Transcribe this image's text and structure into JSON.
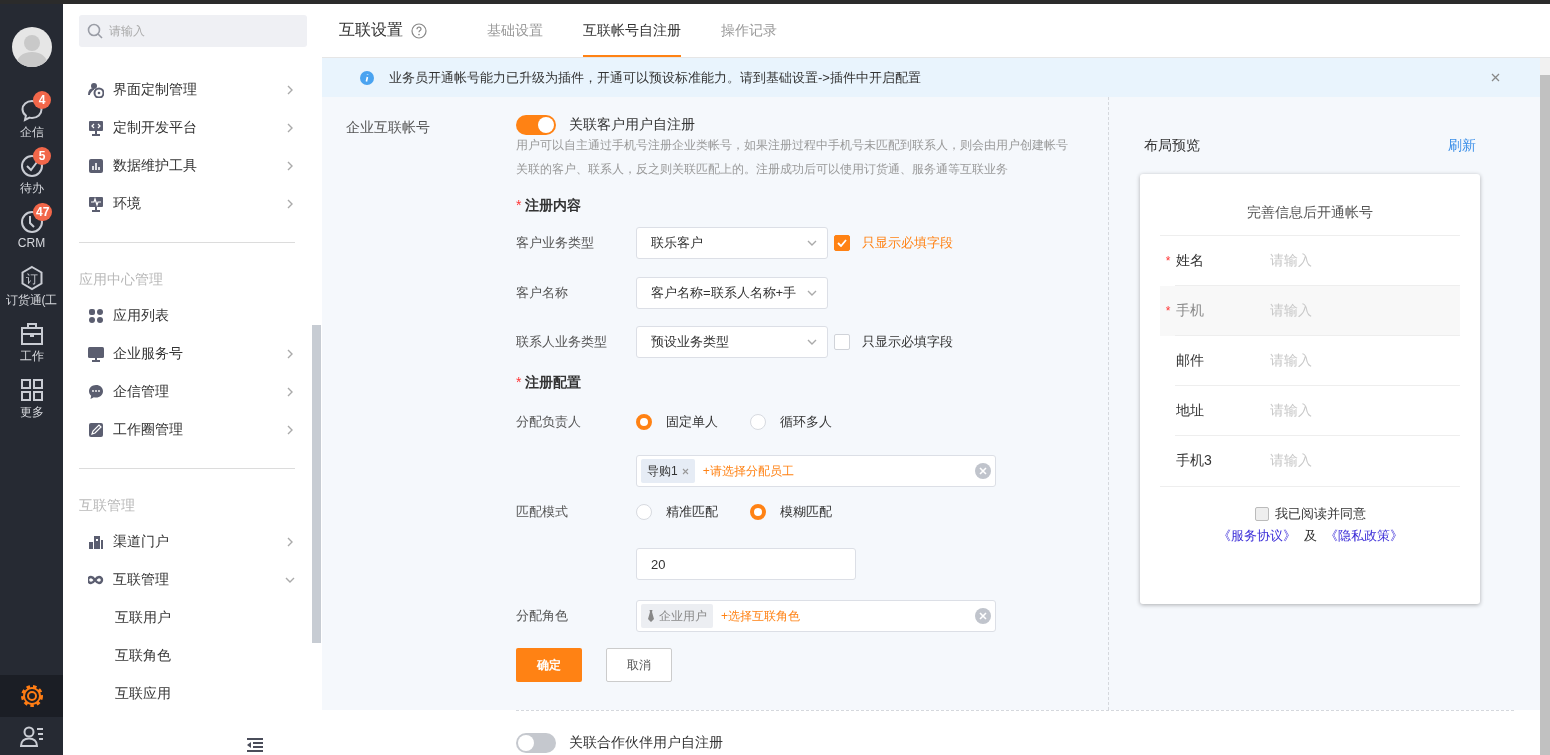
{
  "rail": {
    "items": [
      {
        "kind": "chat",
        "label": "企信",
        "badge": "4"
      },
      {
        "kind": "todo",
        "label": "待办",
        "badge": "5"
      },
      {
        "kind": "crm",
        "label": "CRM",
        "badge": "47"
      },
      {
        "kind": "order",
        "label": "订货通(工",
        "icon_char": "订"
      },
      {
        "kind": "work",
        "label": "工作"
      },
      {
        "kind": "more",
        "label": "更多"
      }
    ],
    "bottom": [
      {
        "kind": "settings",
        "selected": true
      },
      {
        "kind": "contacts",
        "selected": false
      }
    ]
  },
  "menu": {
    "search": {
      "placeholder": "请输入"
    },
    "sections": [
      {
        "items": [
          {
            "kind": "ui",
            "label": "界面定制管理",
            "expanded": false
          },
          {
            "kind": "dev",
            "label": "定制开发平台",
            "expanded": false
          },
          {
            "kind": "data",
            "label": "数据维护工具",
            "expanded": false
          },
          {
            "kind": "env",
            "label": "环境",
            "expanded": false
          }
        ]
      },
      {
        "title": "应用中心管理",
        "items": [
          {
            "kind": "apps",
            "label": "应用列表"
          },
          {
            "kind": "service",
            "label": "企业服务号",
            "expanded": false
          },
          {
            "kind": "chat",
            "label": "企信管理",
            "expanded": false
          },
          {
            "kind": "moments",
            "label": "工作圈管理",
            "expanded": false
          }
        ]
      },
      {
        "title": "互联管理",
        "items": [
          {
            "kind": "channel",
            "label": "渠道门户",
            "expanded": false
          },
          {
            "kind": "link",
            "label": "互联管理",
            "expanded": true,
            "children": [
              {
                "label": "互联用户"
              },
              {
                "label": "互联角色"
              },
              {
                "label": "互联应用"
              }
            ]
          }
        ]
      }
    ]
  },
  "header": {
    "title": "互联设置",
    "tabs": [
      {
        "label": "基础设置",
        "selected": false
      },
      {
        "label": "互联帐号自注册",
        "selected": true
      },
      {
        "label": "操作记录",
        "selected": false
      }
    ]
  },
  "notice": {
    "text": "业务员开通帐号能力已升级为插件，开通可以预设标准能力。请到基础设置->插件中开启配置"
  },
  "form": {
    "section_label": "企业互联帐号",
    "toggle": {
      "on": true,
      "label": "关联客户用户自注册"
    },
    "description": "用户可以自主通过手机号注册企业类帐号，如果注册过程中手机号未匹配到联系人，则会由用户创建帐号关联的客户、联系人，反之则关联匹配上的。注册成功后可以使用订货通、服务通等互联业务",
    "groups": [
      {
        "title": "注册内容",
        "mark": "*",
        "rows": [
          {
            "kind": "select",
            "label": "客户业务类型",
            "value": "联乐客户",
            "checkbox": {
              "checked": true,
              "label": "只显示必填字段"
            }
          },
          {
            "kind": "select",
            "label": "客户名称",
            "value": "客户名称=联系人名称+手"
          },
          {
            "kind": "select",
            "label": "联系人业务类型",
            "value": "预设业务类型",
            "checkbox": {
              "checked": false,
              "label": "只显示必填字段"
            }
          }
        ]
      },
      {
        "title": "注册配置",
        "mark": "*",
        "rows": [
          {
            "kind": "radio",
            "label": "分配负责人",
            "options": [
              {
                "label": "固定单人",
                "selected": true
              },
              {
                "label": "循环多人",
                "selected": false
              }
            ]
          },
          {
            "kind": "tags",
            "tags": [
              {
                "kind": "employee",
                "label": "导购1"
              }
            ],
            "add": "+请选择分配员工"
          },
          {
            "kind": "radio",
            "label": "匹配模式",
            "options": [
              {
                "label": "精准匹配",
                "selected": false
              },
              {
                "label": "模糊匹配",
                "selected": true
              }
            ]
          },
          {
            "kind": "input",
            "value": "20"
          },
          {
            "kind": "tags",
            "label": "分配角色",
            "tags": [
              {
                "kind": "role",
                "label": "企业用户"
              }
            ],
            "add": "+选择互联角色"
          }
        ]
      }
    ],
    "buttons": [
      {
        "kind": "primary",
        "label": "确定"
      },
      {
        "kind": "default",
        "label": "取消"
      }
    ],
    "partner_toggle": {
      "on": false,
      "label": "关联合作伙伴用户自注册"
    }
  },
  "preview": {
    "title": "布局预览",
    "refresh": "刷新",
    "card_title": "完善信息后开通帐号",
    "fields": [
      {
        "label": "姓名",
        "mark": "*",
        "placeholder": "请输入",
        "selected": false
      },
      {
        "label": "手机",
        "mark": "*",
        "placeholder": "请输入",
        "selected": true
      },
      {
        "label": "邮件",
        "placeholder": "请输入",
        "selected": false
      },
      {
        "label": "地址",
        "placeholder": "请输入",
        "selected": false
      },
      {
        "label": "手机3",
        "placeholder": "请输入",
        "selected": false
      }
    ],
    "agree": {
      "checked": false,
      "label": "我已阅读并同意",
      "links": [
        "《服务协议》",
        "《隐私政策》"
      ],
      "joiner": "及"
    }
  }
}
